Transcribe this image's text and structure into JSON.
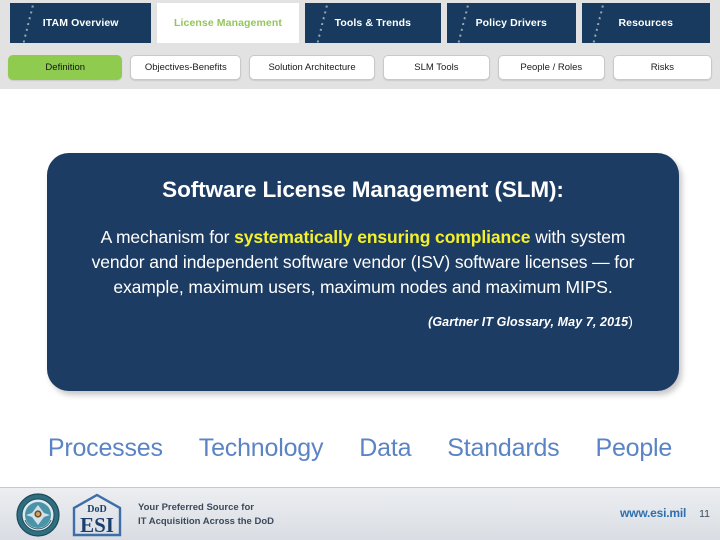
{
  "top_nav": {
    "tabs": [
      {
        "label": "ITAM Overview",
        "active": false
      },
      {
        "label": "License Management",
        "active": true
      },
      {
        "label": "Tools & Trends",
        "active": false
      },
      {
        "label": "Policy Drivers",
        "active": false
      },
      {
        "label": "Resources",
        "active": false
      }
    ],
    "active_color": "#93c65a",
    "tab_color": "#173a5e",
    "strip_color": "#e2e2e2"
  },
  "sub_nav": {
    "items": [
      {
        "label": "Definition",
        "active": true
      },
      {
        "label": "Objectives-Benefits",
        "active": false
      },
      {
        "label": "Solution Architecture",
        "active": false
      },
      {
        "label": "SLM Tools",
        "active": false
      },
      {
        "label": "People / Roles",
        "active": false
      },
      {
        "label": "Risks",
        "active": false
      }
    ],
    "active_color": "#8ecb4f"
  },
  "callout": {
    "title": "Software License Management (SLM):",
    "body_part1": "A mechanism for ",
    "body_highlight": "systematically ensuring compliance",
    "body_part2": " with system vendor and independent software vendor (ISV) software licenses — for example, maximum users, maximum nodes and maximum MIPS.",
    "citation": "(Gartner IT Glossary, May 7, 2015",
    "citation_close": ")",
    "background_color": "#1d3c63",
    "highlight_color": "#f4f12c"
  },
  "pillars": {
    "items": [
      "Processes",
      "Technology",
      "Data",
      "Standards",
      "People"
    ],
    "color": "#5b84c4"
  },
  "footer": {
    "seal_label": "dod-seal",
    "logo_dod": "DoD",
    "logo_esi": "ESI",
    "tagline_line1": "Your Preferred Source for",
    "tagline_line2": "IT Acquisition Across the DoD",
    "url": "www.esi.mil",
    "page_number": "11",
    "url_color": "#2e6fb0"
  }
}
